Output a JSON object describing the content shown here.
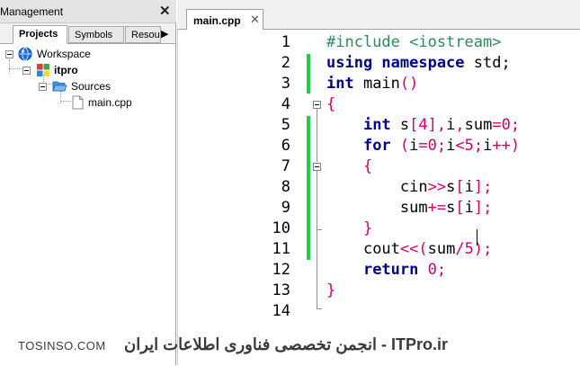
{
  "management": {
    "title": "Management",
    "tabs": [
      "Projects",
      "Symbols",
      "Resou"
    ],
    "tree": {
      "workspace": "Workspace",
      "project": "itpro",
      "folder": "Sources",
      "file": "main.cpp"
    }
  },
  "editor": {
    "tab_label": "main.cpp",
    "line_numbers": [
      "1",
      "2",
      "3",
      "4",
      "5",
      "6",
      "7",
      "8",
      "9",
      "10",
      "11",
      "12",
      "13",
      "14"
    ],
    "lines": [
      [
        {
          "t": "#include <iostream>",
          "c": "pp"
        }
      ],
      [
        {
          "t": "using namespace",
          "c": "kw"
        },
        {
          "t": " std;",
          "c": "id"
        }
      ],
      [
        {
          "t": "int",
          "c": "kw"
        },
        {
          "t": " main",
          "c": "id"
        },
        {
          "t": "()",
          "c": "op"
        }
      ],
      [
        {
          "t": "{",
          "c": "op"
        }
      ],
      [
        {
          "t": "    "
        },
        {
          "t": "int",
          "c": "kw"
        },
        {
          "t": " s",
          "c": "id"
        },
        {
          "t": "[",
          "c": "op"
        },
        {
          "t": "4",
          "c": "num"
        },
        {
          "t": "],",
          "c": "op"
        },
        {
          "t": "i",
          "c": "id"
        },
        {
          "t": ",",
          "c": "op"
        },
        {
          "t": "sum",
          "c": "id"
        },
        {
          "t": "=",
          "c": "op"
        },
        {
          "t": "0",
          "c": "num"
        },
        {
          "t": ";",
          "c": "op"
        }
      ],
      [
        {
          "t": "    "
        },
        {
          "t": "for",
          "c": "kw"
        },
        {
          "t": " (",
          "c": "op"
        },
        {
          "t": "i",
          "c": "id"
        },
        {
          "t": "=",
          "c": "op"
        },
        {
          "t": "0",
          "c": "num"
        },
        {
          "t": ";",
          "c": "op"
        },
        {
          "t": "i",
          "c": "id"
        },
        {
          "t": "<",
          "c": "op"
        },
        {
          "t": "5",
          "c": "num"
        },
        {
          "t": ";",
          "c": "op"
        },
        {
          "t": "i",
          "c": "id"
        },
        {
          "t": "++)",
          "c": "op"
        }
      ],
      [
        {
          "t": "    "
        },
        {
          "t": "{",
          "c": "op"
        }
      ],
      [
        {
          "t": "        "
        },
        {
          "t": "cin",
          "c": "id"
        },
        {
          "t": ">>",
          "c": "op"
        },
        {
          "t": "s",
          "c": "id"
        },
        {
          "t": "[",
          "c": "op"
        },
        {
          "t": "i",
          "c": "id"
        },
        {
          "t": "];",
          "c": "op"
        }
      ],
      [
        {
          "t": "        "
        },
        {
          "t": "sum",
          "c": "id"
        },
        {
          "t": "+=",
          "c": "op"
        },
        {
          "t": "s",
          "c": "id"
        },
        {
          "t": "[",
          "c": "op"
        },
        {
          "t": "i",
          "c": "id"
        },
        {
          "t": "];",
          "c": "op"
        }
      ],
      [
        {
          "t": "    "
        },
        {
          "t": "}",
          "c": "op"
        }
      ],
      [
        {
          "t": "    "
        },
        {
          "t": "cout",
          "c": "id"
        },
        {
          "t": "<<(",
          "c": "op"
        },
        {
          "t": "sum",
          "c": "id"
        },
        {
          "t": "/",
          "c": "op"
        },
        {
          "t": "5",
          "c": "num"
        },
        {
          "t": ");",
          "c": "op"
        }
      ],
      [
        {
          "t": "    "
        },
        {
          "t": "return",
          "c": "kw"
        },
        {
          "t": " ",
          "c": "id"
        },
        {
          "t": "0",
          "c": "num"
        },
        {
          "t": ";",
          "c": "op"
        }
      ],
      [
        {
          "t": "}",
          "c": "op"
        }
      ],
      []
    ]
  },
  "watermark": {
    "left": "TOSINSO.COM",
    "right": "انجمن تخصصی فناوری اطلاعات ایران - ITPro.ir"
  },
  "colors": {
    "keyword": "#00008b",
    "preprocessor": "#2e8b57",
    "operator": "#d0006f",
    "change_bar": "#22cc44"
  }
}
